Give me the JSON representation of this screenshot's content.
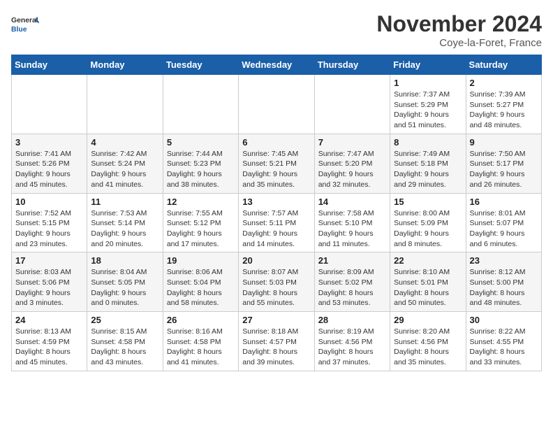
{
  "header": {
    "logo_general": "General",
    "logo_blue": "Blue",
    "month_title": "November 2024",
    "location": "Coye-la-Foret, France"
  },
  "weekdays": [
    "Sunday",
    "Monday",
    "Tuesday",
    "Wednesday",
    "Thursday",
    "Friday",
    "Saturday"
  ],
  "weeks": [
    [
      {
        "day": "",
        "info": ""
      },
      {
        "day": "",
        "info": ""
      },
      {
        "day": "",
        "info": ""
      },
      {
        "day": "",
        "info": ""
      },
      {
        "day": "",
        "info": ""
      },
      {
        "day": "1",
        "info": "Sunrise: 7:37 AM\nSunset: 5:29 PM\nDaylight: 9 hours and 51 minutes."
      },
      {
        "day": "2",
        "info": "Sunrise: 7:39 AM\nSunset: 5:27 PM\nDaylight: 9 hours and 48 minutes."
      }
    ],
    [
      {
        "day": "3",
        "info": "Sunrise: 7:41 AM\nSunset: 5:26 PM\nDaylight: 9 hours and 45 minutes."
      },
      {
        "day": "4",
        "info": "Sunrise: 7:42 AM\nSunset: 5:24 PM\nDaylight: 9 hours and 41 minutes."
      },
      {
        "day": "5",
        "info": "Sunrise: 7:44 AM\nSunset: 5:23 PM\nDaylight: 9 hours and 38 minutes."
      },
      {
        "day": "6",
        "info": "Sunrise: 7:45 AM\nSunset: 5:21 PM\nDaylight: 9 hours and 35 minutes."
      },
      {
        "day": "7",
        "info": "Sunrise: 7:47 AM\nSunset: 5:20 PM\nDaylight: 9 hours and 32 minutes."
      },
      {
        "day": "8",
        "info": "Sunrise: 7:49 AM\nSunset: 5:18 PM\nDaylight: 9 hours and 29 minutes."
      },
      {
        "day": "9",
        "info": "Sunrise: 7:50 AM\nSunset: 5:17 PM\nDaylight: 9 hours and 26 minutes."
      }
    ],
    [
      {
        "day": "10",
        "info": "Sunrise: 7:52 AM\nSunset: 5:15 PM\nDaylight: 9 hours and 23 minutes."
      },
      {
        "day": "11",
        "info": "Sunrise: 7:53 AM\nSunset: 5:14 PM\nDaylight: 9 hours and 20 minutes."
      },
      {
        "day": "12",
        "info": "Sunrise: 7:55 AM\nSunset: 5:12 PM\nDaylight: 9 hours and 17 minutes."
      },
      {
        "day": "13",
        "info": "Sunrise: 7:57 AM\nSunset: 5:11 PM\nDaylight: 9 hours and 14 minutes."
      },
      {
        "day": "14",
        "info": "Sunrise: 7:58 AM\nSunset: 5:10 PM\nDaylight: 9 hours and 11 minutes."
      },
      {
        "day": "15",
        "info": "Sunrise: 8:00 AM\nSunset: 5:09 PM\nDaylight: 9 hours and 8 minutes."
      },
      {
        "day": "16",
        "info": "Sunrise: 8:01 AM\nSunset: 5:07 PM\nDaylight: 9 hours and 6 minutes."
      }
    ],
    [
      {
        "day": "17",
        "info": "Sunrise: 8:03 AM\nSunset: 5:06 PM\nDaylight: 9 hours and 3 minutes."
      },
      {
        "day": "18",
        "info": "Sunrise: 8:04 AM\nSunset: 5:05 PM\nDaylight: 9 hours and 0 minutes."
      },
      {
        "day": "19",
        "info": "Sunrise: 8:06 AM\nSunset: 5:04 PM\nDaylight: 8 hours and 58 minutes."
      },
      {
        "day": "20",
        "info": "Sunrise: 8:07 AM\nSunset: 5:03 PM\nDaylight: 8 hours and 55 minutes."
      },
      {
        "day": "21",
        "info": "Sunrise: 8:09 AM\nSunset: 5:02 PM\nDaylight: 8 hours and 53 minutes."
      },
      {
        "day": "22",
        "info": "Sunrise: 8:10 AM\nSunset: 5:01 PM\nDaylight: 8 hours and 50 minutes."
      },
      {
        "day": "23",
        "info": "Sunrise: 8:12 AM\nSunset: 5:00 PM\nDaylight: 8 hours and 48 minutes."
      }
    ],
    [
      {
        "day": "24",
        "info": "Sunrise: 8:13 AM\nSunset: 4:59 PM\nDaylight: 8 hours and 45 minutes."
      },
      {
        "day": "25",
        "info": "Sunrise: 8:15 AM\nSunset: 4:58 PM\nDaylight: 8 hours and 43 minutes."
      },
      {
        "day": "26",
        "info": "Sunrise: 8:16 AM\nSunset: 4:58 PM\nDaylight: 8 hours and 41 minutes."
      },
      {
        "day": "27",
        "info": "Sunrise: 8:18 AM\nSunset: 4:57 PM\nDaylight: 8 hours and 39 minutes."
      },
      {
        "day": "28",
        "info": "Sunrise: 8:19 AM\nSunset: 4:56 PM\nDaylight: 8 hours and 37 minutes."
      },
      {
        "day": "29",
        "info": "Sunrise: 8:20 AM\nSunset: 4:56 PM\nDaylight: 8 hours and 35 minutes."
      },
      {
        "day": "30",
        "info": "Sunrise: 8:22 AM\nSunset: 4:55 PM\nDaylight: 8 hours and 33 minutes."
      }
    ]
  ]
}
